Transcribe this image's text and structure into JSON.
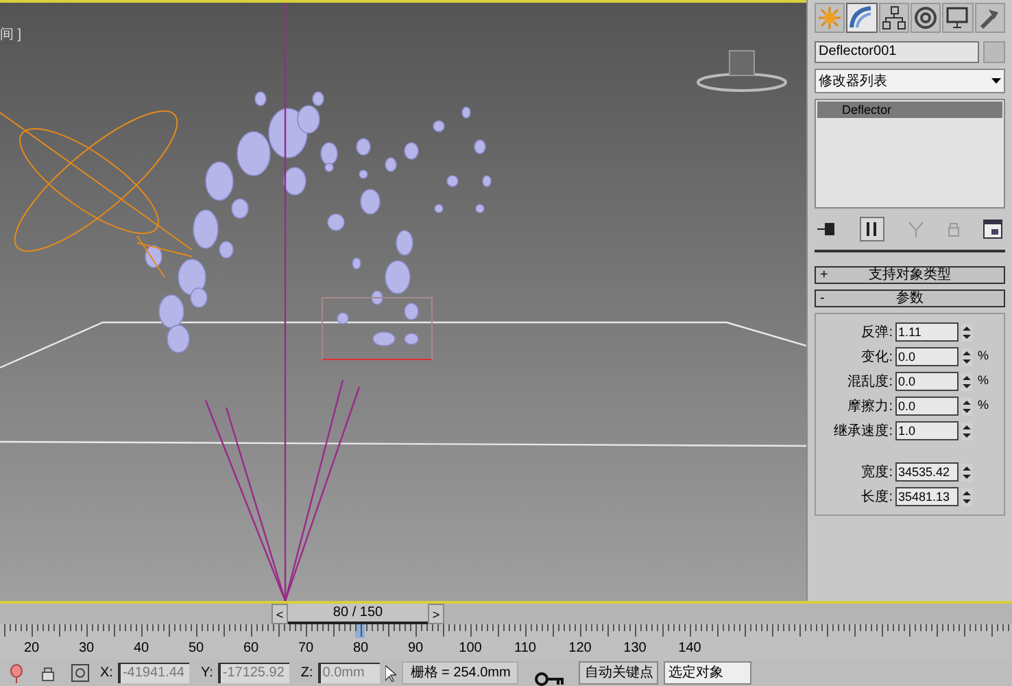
{
  "viewport": {
    "label": "间 ]"
  },
  "command_panel": {
    "tabs": [
      {
        "kind": "create",
        "selected": false
      },
      {
        "kind": "modify",
        "selected": true
      },
      {
        "kind": "hierarchy",
        "selected": false
      },
      {
        "kind": "motion",
        "selected": false
      },
      {
        "kind": "display",
        "selected": false
      },
      {
        "kind": "utilities",
        "selected": false
      }
    ],
    "object_name": "Deflector001",
    "modifier_list": "修改器列表",
    "stack": [
      {
        "label": "Deflector",
        "selected": true
      }
    ],
    "rollouts": [
      {
        "sign": "+",
        "title": "支持对象类型"
      },
      {
        "sign": "-",
        "title": "参数",
        "param_groups": [
          {
            "params": [
              {
                "label": "反弹:",
                "value": "1.11"
              },
              {
                "label": "变化:",
                "value": "0.0",
                "unit": "%"
              },
              {
                "label": "混乱度:",
                "value": "0.0",
                "unit": "%"
              },
              {
                "label": "摩擦力:",
                "value": "0.0",
                "unit": "%"
              },
              {
                "label": "继承速度:",
                "value": "1.0"
              }
            ]
          },
          {
            "params": [
              {
                "label": "宽度:",
                "value": "34535.42"
              },
              {
                "label": "长度:",
                "value": "35481.13"
              }
            ]
          }
        ]
      }
    ]
  },
  "time_slider": {
    "prev": "<",
    "label": "80 / 150",
    "next": ">"
  },
  "ruler": {
    "labels": [
      "20",
      "30",
      "40",
      "50",
      "60",
      "70",
      "80",
      "90",
      "100",
      "110",
      "120",
      "130",
      "140"
    ]
  },
  "status_bar": {
    "x_label": "X:",
    "x_value": "-41941.44",
    "y_label": "Y:",
    "y_value": "-17125.92",
    "z_label": "Z:",
    "z_value": "0.0mm",
    "grid": "栅格 = 254.0mm",
    "auto_key": "自动关键点",
    "selection": "选定对象"
  }
}
